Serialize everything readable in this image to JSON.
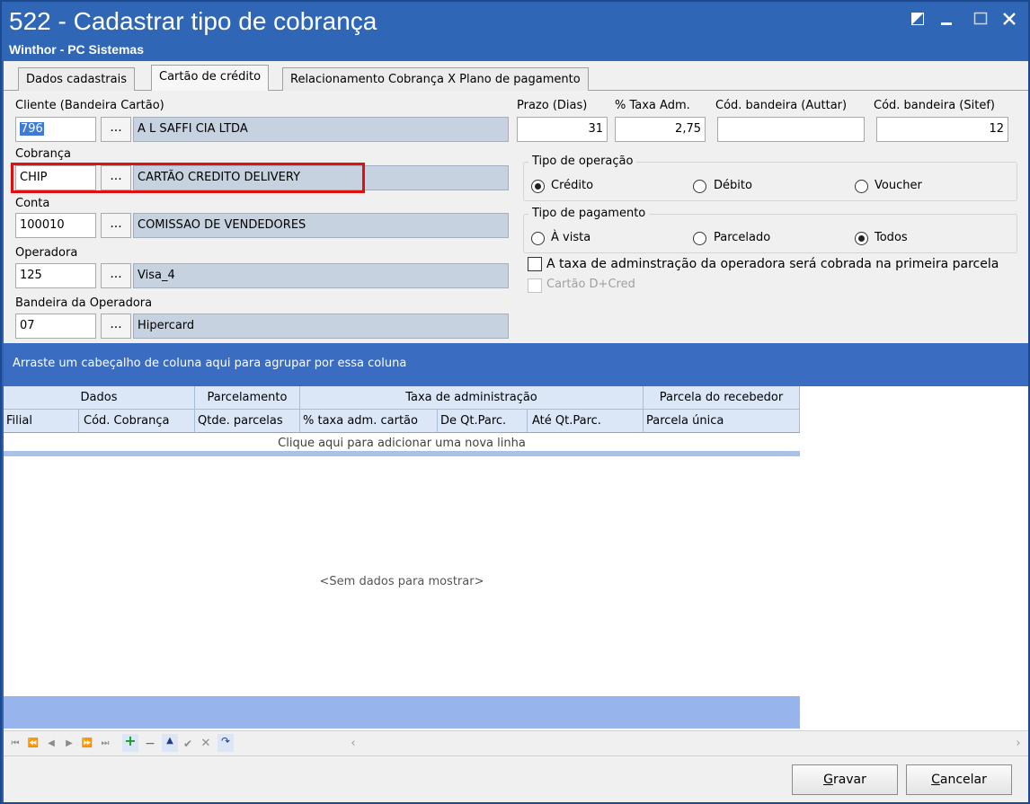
{
  "window": {
    "title": "522 - Cadastrar tipo de cobrança",
    "subtitle": "Winthor - PC Sistemas"
  },
  "tabs": [
    {
      "label": "Dados cadastrais",
      "active": false
    },
    {
      "label": "Cartão de crédito",
      "active": true
    },
    {
      "label": "Relacionamento Cobrança X Plano de pagamento",
      "active": false
    }
  ],
  "form": {
    "cliente": {
      "label": "Cliente (Bandeira Cartão)",
      "code": "796",
      "dots": "...",
      "desc": "A L SAFFI CIA LTDA"
    },
    "cobranca": {
      "label": "Cobrança",
      "code": "CHIP",
      "dots": "...",
      "desc": "CARTÃO CREDITO DELIVERY"
    },
    "conta": {
      "label": "Conta",
      "code": "100010",
      "dots": "...",
      "desc": "COMISSAO DE VENDEDORES"
    },
    "operadora": {
      "label": "Operadora",
      "code": "125",
      "dots": "...",
      "desc": "Visa_4"
    },
    "bandeira_operadora": {
      "label": "Bandeira da Operadora",
      "code": "07",
      "dots": "...",
      "desc": "Hipercard"
    },
    "prazo": {
      "label": "Prazo (Dias)",
      "value": "31"
    },
    "taxa_adm": {
      "label": "% Taxa Adm.",
      "value": "2,75"
    },
    "cod_auttar": {
      "label": "Cód. bandeira (Auttar)",
      "value": ""
    },
    "cod_sitef": {
      "label": "Cód. bandeira (Sitef)",
      "value": "12"
    },
    "tipo_operacao": {
      "title": "Tipo de operação",
      "options": [
        {
          "label": "Crédito",
          "selected": true
        },
        {
          "label": "Débito",
          "selected": false
        },
        {
          "label": "Voucher",
          "selected": false
        }
      ]
    },
    "tipo_pagamento": {
      "title": "Tipo de pagamento",
      "options": [
        {
          "label": "À vista",
          "selected": false
        },
        {
          "label": "Parcelado",
          "selected": false
        },
        {
          "label": "Todos",
          "selected": true
        }
      ]
    },
    "taxa_primeira_parcela": {
      "label": "A taxa de adminstração da operadora será cobrada na primeira parcela",
      "checked": false
    },
    "cartao_dcred": {
      "label": "Cartão D+Cred",
      "checked": false,
      "enabled": false
    }
  },
  "grid": {
    "group_panel_text": "Arraste um cabeçalho de coluna aqui para agrupar por essa coluna",
    "bands": [
      "Dados",
      "Parcelamento",
      "Taxa de administração",
      "Parcela do recebedor"
    ],
    "columns": [
      "Filial",
      "Cód. Cobrança",
      "Qtde. parcelas",
      "% taxa adm. cartão",
      "De Qt.Parc.",
      "Até Qt.Parc.",
      "Parcela única"
    ],
    "new_row_text": "Clique aqui para adicionar uma nova linha",
    "empty_text": "<Sem dados para mostrar>",
    "rows": []
  },
  "buttons": {
    "gravar": {
      "label_first": "G",
      "label_rest": "ravar"
    },
    "cancelar": {
      "label_first": "C",
      "label_rest": "ancelar"
    }
  },
  "colors": {
    "titlebar": "#2f67b6",
    "group_panel": "#3a6cc1",
    "highlight": "#e01010"
  }
}
